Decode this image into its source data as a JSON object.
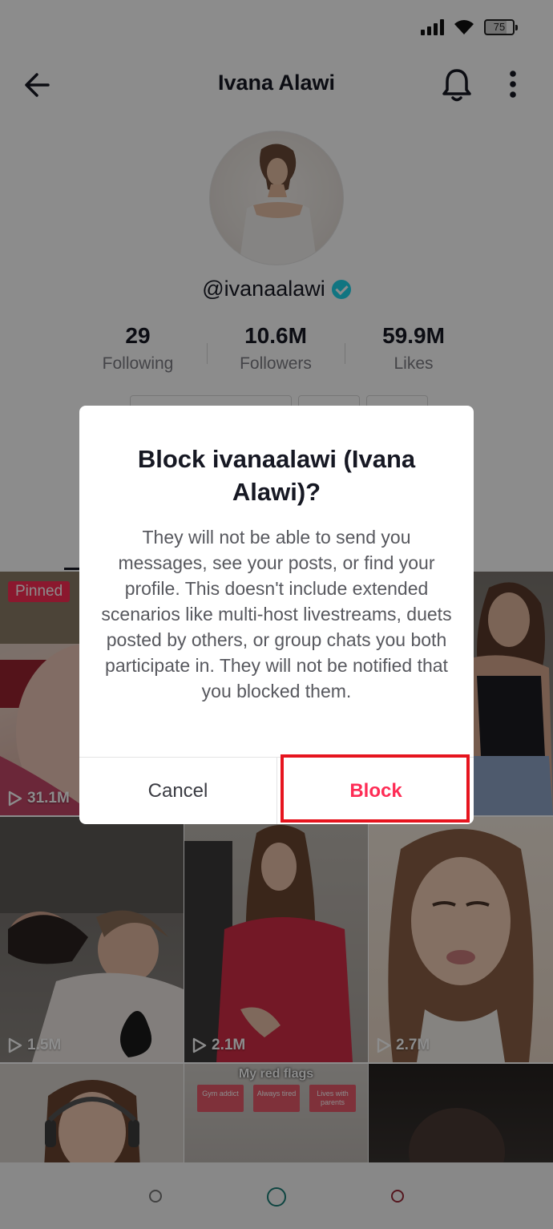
{
  "status_bar": {
    "battery_level": "75"
  },
  "header": {
    "title": "Ivana Alawi"
  },
  "profile": {
    "handle": "@ivanaalawi",
    "verified": true,
    "stats": [
      {
        "value": "29",
        "label": "Following"
      },
      {
        "value": "10.6M",
        "label": "Followers"
      },
      {
        "value": "59.9M",
        "label": "Likes"
      }
    ]
  },
  "videos": [
    {
      "views": "31.1M",
      "pinned_label": "Pinned"
    },
    {
      "views": "1.5M"
    },
    {
      "views": "2.1M"
    },
    {
      "views": "2.7M"
    }
  ],
  "flags_video": {
    "title": "My red flags",
    "flags": [
      "Gym addict",
      "Always tired",
      "Lives with parents"
    ]
  },
  "dialog": {
    "title": "Block ivanaalawi (Ivana Alawi)?",
    "body": "They will not be able to send you messages, see your posts, or find your profile. This doesn't include extended scenarios like multi-host livestreams, duets posted by others, or group chats you both participate in. They will not be notified that you blocked them.",
    "cancel_label": "Cancel",
    "block_label": "Block"
  },
  "colors": {
    "accent": "#fe2c55",
    "highlight_box": "#e6141e",
    "verified": "#20d5ec"
  }
}
